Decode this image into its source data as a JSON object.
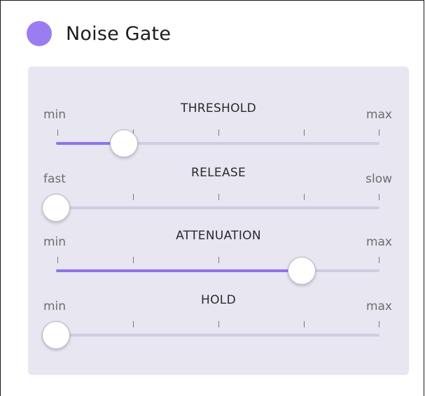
{
  "header": {
    "title": "Noise Gate",
    "dot_color": "#9a7df0"
  },
  "sliders": [
    {
      "title": "THRESHOLD",
      "min_label": "min",
      "max_label": "max",
      "value": 0.21
    },
    {
      "title": "RELEASE",
      "min_label": "fast",
      "max_label": "slow",
      "value": 0.0
    },
    {
      "title": "ATTENUATION",
      "min_label": "min",
      "max_label": "max",
      "value": 0.76
    },
    {
      "title": "HOLD",
      "min_label": "min",
      "max_label": "max",
      "value": 0.0
    }
  ],
  "colors": {
    "accent": "#8f73ea",
    "track": "#cfcde0",
    "panel": "#e7e6f1"
  }
}
